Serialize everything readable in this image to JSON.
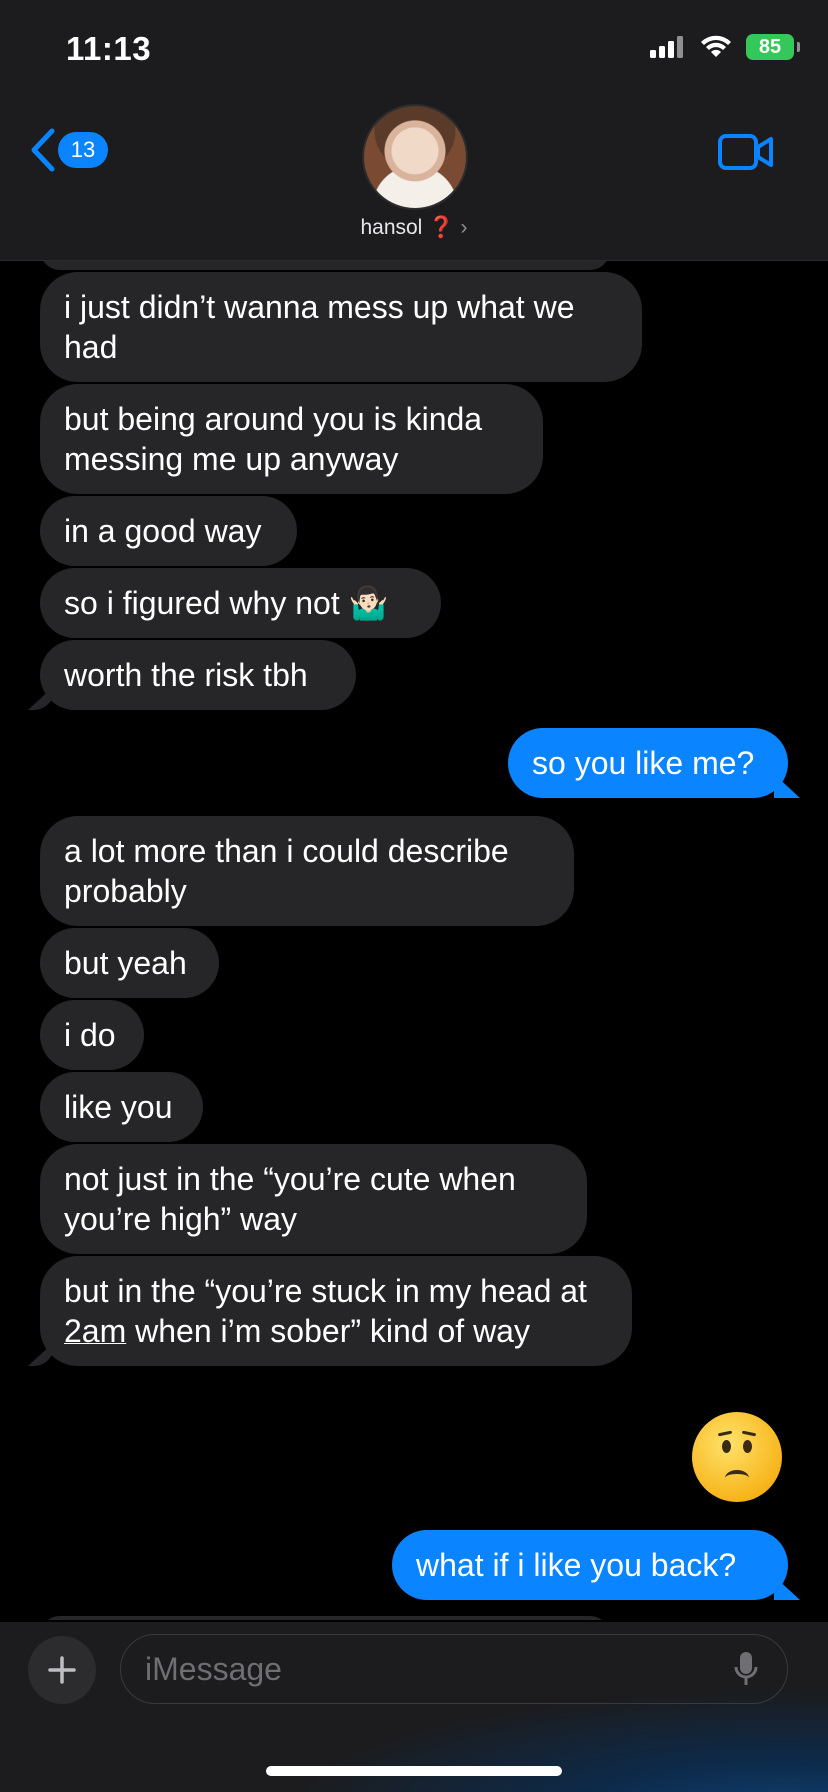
{
  "status_bar": {
    "time": "11:13",
    "battery": "85"
  },
  "header": {
    "back_count": "13",
    "contact_name": "hansol",
    "contact_emoji": "❓",
    "chevron": "›",
    "icons": [
      "back-chevron-icon",
      "video-camera-icon"
    ]
  },
  "messages": [
    {
      "from": "them",
      "text": "i just didn’t wanna mess up what we had"
    },
    {
      "from": "them",
      "text": "but being around you is kinda messing me up anyway"
    },
    {
      "from": "them",
      "text": "in a good way"
    },
    {
      "from": "them",
      "text": "so i figured why not 🤷🏻‍♂️"
    },
    {
      "from": "them",
      "text": "worth the risk tbh"
    },
    {
      "from": "me",
      "text": "so you like me?"
    },
    {
      "from": "them",
      "text": "a lot more than i could describe probably"
    },
    {
      "from": "them",
      "text": "but yeah"
    },
    {
      "from": "them",
      "text": "i do"
    },
    {
      "from": "them",
      "text": "like you"
    },
    {
      "from": "them",
      "text": "not just in the “you’re cute when you’re high” way"
    },
    {
      "from": "them",
      "text_before": "but in the “you’re stuck in my head at ",
      "text_link": "2am",
      "text_after": " when i’m sober” kind of way"
    },
    {
      "from": "me",
      "emoji": "😦"
    },
    {
      "from": "me",
      "text": "what if i like you back?"
    }
  ],
  "composer": {
    "placeholder": "iMessage",
    "icons": [
      "plus-icon",
      "microphone-icon"
    ]
  },
  "colors": {
    "outgoing": "#0a84ff",
    "incoming": "#262628",
    "battery": "#34c759"
  }
}
